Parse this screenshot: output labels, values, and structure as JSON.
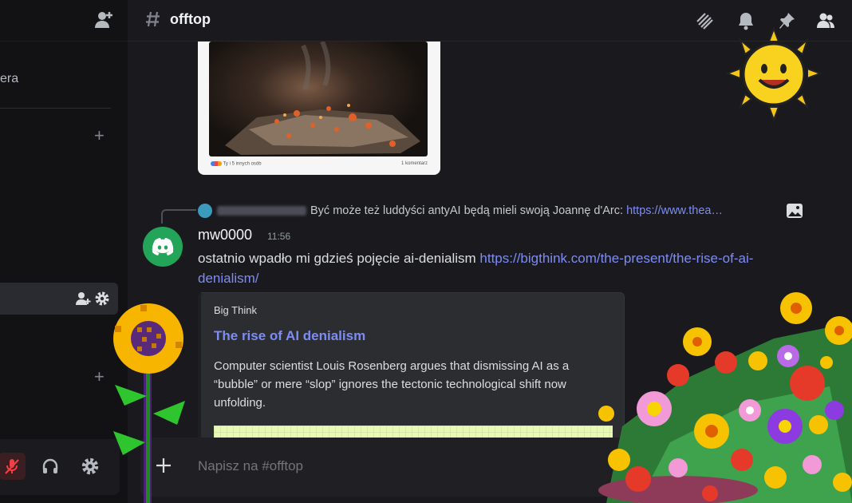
{
  "sidebar": {
    "partial_text": "era",
    "plus_labels": [
      "+",
      "+"
    ],
    "invite_icon": "add-user-icon",
    "active_icons": [
      "add-member-icon",
      "gear-icon"
    ],
    "userbar_icons": [
      "microphone-muted-icon",
      "headphones-icon",
      "gear-icon"
    ]
  },
  "header": {
    "channel_name": "offtop",
    "icons": [
      "threads-icon",
      "bell-icon",
      "pin-icon",
      "members-icon"
    ]
  },
  "embed_preview": {
    "footer_left": "Ty i 5 innych osób",
    "footer_right": "1 komentarz"
  },
  "reply": {
    "text": "Być może też luddyści antyAI będą mieli swoją Joannę d'Arc: ",
    "link": "https://www.thea…",
    "icon": "image-icon"
  },
  "message": {
    "author": "mw0000",
    "time": "11:56",
    "text": "ostatnio wpadło mi gdzieś pojęcie ai-denialism ",
    "link": "https://bigthink.com/the-present/the-rise-of-ai-denialism/",
    "avatar_icon": "discord-logo-icon"
  },
  "link_card": {
    "provider": "Big Think",
    "title": "The rise of AI denialism",
    "description": "Computer scientist Louis Rosenberg argues that dismissing AI as a “bubble” or mere “slop” ignores the tectonic technological shift now unfolding."
  },
  "composer": {
    "placeholder": "Napisz na #offtop",
    "plus_icon": "plus-icon"
  },
  "decorations": [
    "pixel-sun-icon",
    "pixel-sunflower-icon",
    "pixel-flower-bush-icon"
  ],
  "colors": {
    "accent_link": "#7d8cf5",
    "avatar_green": "#23a559",
    "muted_red": "#f23f43"
  }
}
